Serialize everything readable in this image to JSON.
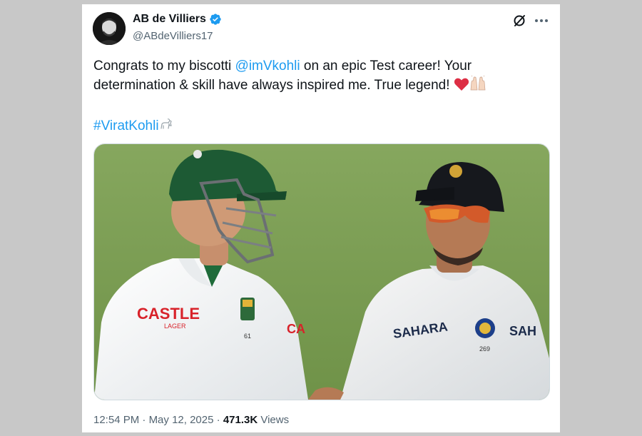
{
  "author": {
    "name": "AB de Villiers",
    "handle": "@ABdeVilliers17",
    "verified": true,
    "verified_color": "#1d9bf0"
  },
  "header_icons": [
    "grok-icon",
    "more-icon"
  ],
  "tweet": {
    "line1_prefix": "Congrats to my biscotti ",
    "mention": "@imVkohli",
    "line1_suffix": " on an epic Test career! Your determination & skill have always inspired me. True legend!",
    "emojis": [
      "red-heart-icon",
      "raising-hands-icon"
    ],
    "hashtag": "#ViratKohli",
    "hashtag_emoji": "goat-icon"
  },
  "media": {
    "description_icon": "photo-two-cricketers"
  },
  "meta": {
    "time": "12:54 PM",
    "separator": "·",
    "date": "May 12, 2025",
    "views_count": "471.3K",
    "views_label": "Views"
  },
  "colors": {
    "link": "#1d9bf0",
    "text": "#0f1419",
    "secondary": "#536471",
    "page_bg": "#c8c8c8"
  }
}
